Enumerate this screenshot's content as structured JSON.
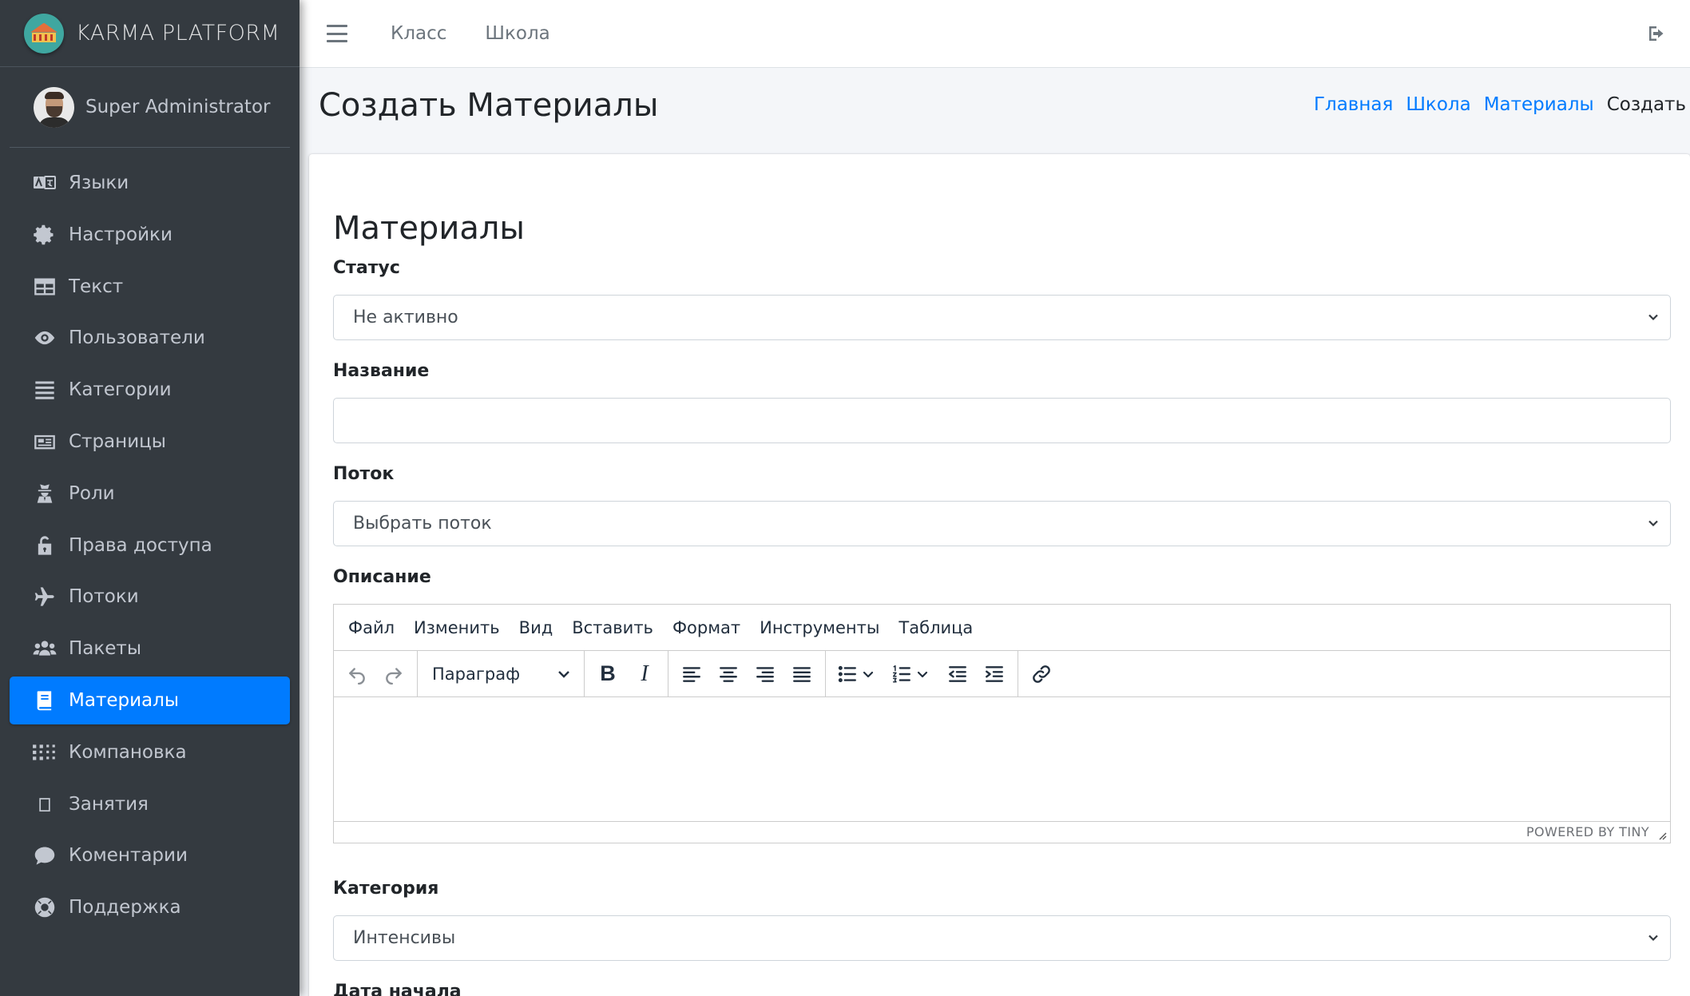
{
  "brand": {
    "name": "KARMA PLATFORM"
  },
  "user": {
    "name": "Super Administrator"
  },
  "sidebar": {
    "items": [
      {
        "label": "Языки",
        "icon": "language-icon"
      },
      {
        "label": "Настройки",
        "icon": "gear-icon"
      },
      {
        "label": "Текст",
        "icon": "table-icon"
      },
      {
        "label": "Пользователи",
        "icon": "eye-icon"
      },
      {
        "label": "Категории",
        "icon": "list-icon"
      },
      {
        "label": "Страницы",
        "icon": "newspaper-icon"
      },
      {
        "label": "Роли",
        "icon": "user-secret-icon"
      },
      {
        "label": "Права доступа",
        "icon": "unlock-icon"
      },
      {
        "label": "Потоки",
        "icon": "plane-icon"
      },
      {
        "label": "Пакеты",
        "icon": "users-icon"
      },
      {
        "label": "Материалы",
        "icon": "book-icon",
        "active": true
      },
      {
        "label": "Компановка",
        "icon": "grid-dots-icon"
      },
      {
        "label": "Занятия",
        "icon": "square-icon"
      },
      {
        "label": "Коментарии",
        "icon": "comment-icon"
      },
      {
        "label": "Поддержка",
        "icon": "life-ring-icon"
      }
    ]
  },
  "topbar": {
    "links": [
      "Класс",
      "Школа"
    ],
    "menu_icon": "bars-icon",
    "logout_icon": "sign-out-icon"
  },
  "header": {
    "title": "Создать Материалы",
    "breadcrumb": [
      "Главная",
      "Школа",
      "Материалы"
    ],
    "breadcrumb_current": "Создать"
  },
  "form": {
    "title": "Материалы",
    "status": {
      "label": "Статус",
      "value": "Не активно"
    },
    "name": {
      "label": "Название",
      "value": ""
    },
    "stream": {
      "label": "Поток",
      "value": "Выбрать поток"
    },
    "description": {
      "label": "Описание"
    },
    "category": {
      "label": "Категория",
      "value": "Интенсивы"
    },
    "start_date": {
      "label": "Дата начала"
    }
  },
  "editor": {
    "menu": [
      "Файл",
      "Изменить",
      "Вид",
      "Вставить",
      "Формат",
      "Инструменты",
      "Таблица"
    ],
    "block_format": "Параграф",
    "bold": "B",
    "italic": "I",
    "powered_by": "POWERED BY TINY"
  },
  "colors": {
    "sidebar_bg": "#343a40",
    "accent": "#007bff",
    "link": "#007bff"
  }
}
